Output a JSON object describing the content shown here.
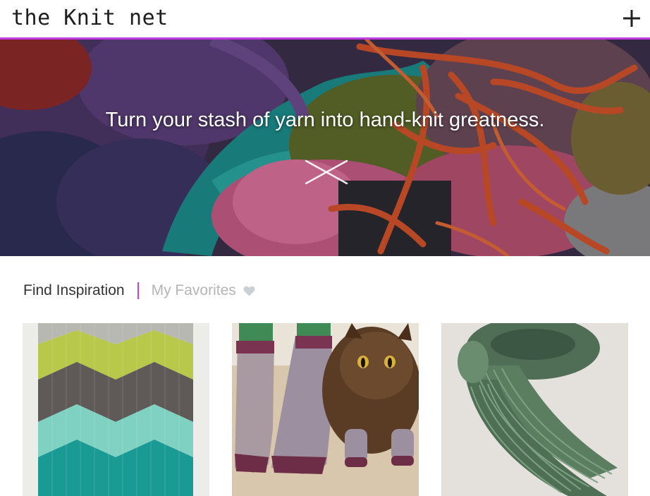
{
  "header": {
    "logo_text": "the Knit net",
    "add_icon": "plus-icon",
    "accent_color": "#c13de6"
  },
  "hero": {
    "tagline": "Turn your stash of yarn into hand-knit greatness.",
    "emblem_icon": "crossed-needles-icon"
  },
  "tabs": {
    "active_label": "Find Inspiration",
    "inactive_label": "My Favorites",
    "favorites_icon": "heart-icon"
  },
  "gallery": [
    {
      "subject": "chevron-blanket"
    },
    {
      "subject": "socks-and-cat"
    },
    {
      "subject": "green-scarf"
    }
  ]
}
